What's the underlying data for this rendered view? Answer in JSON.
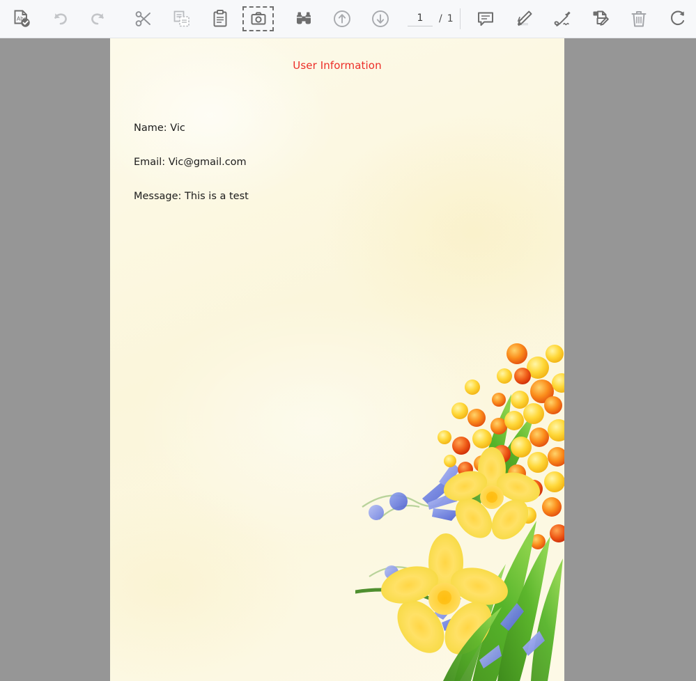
{
  "toolbar": {
    "buttons": [
      {
        "name": "spellcheck-document-icon",
        "label": "Check Document",
        "selected": false
      },
      {
        "name": "undo-icon",
        "label": "Undo",
        "selected": false
      },
      {
        "name": "redo-icon",
        "label": "Redo",
        "selected": false
      },
      {
        "name": "cut-scissors-icon",
        "label": "Cut",
        "selected": false
      },
      {
        "name": "copy-icon",
        "label": "Copy",
        "selected": false
      },
      {
        "name": "paste-clipboard-icon",
        "label": "Paste",
        "selected": false
      },
      {
        "name": "snapshot-camera-icon",
        "label": "Snapshot",
        "selected": true
      },
      {
        "name": "binoculars-find-icon",
        "label": "Find",
        "selected": false
      },
      {
        "name": "previous-page-arrow-up-icon",
        "label": "Previous Page",
        "selected": false
      },
      {
        "name": "next-page-arrow-down-icon",
        "label": "Next Page",
        "selected": false
      }
    ],
    "page_nav": {
      "current_page": "1",
      "separator": "/",
      "total_pages": "1"
    },
    "annotate_buttons": [
      {
        "name": "comment-bubble-icon",
        "label": "Add Comment",
        "selected": false
      },
      {
        "name": "highlighter-pen-icon",
        "label": "Highlight",
        "selected": false
      },
      {
        "name": "signature-pen-icon",
        "label": "Sign",
        "selected": false
      },
      {
        "name": "stamp-edit-document-icon",
        "label": "Edit Document",
        "selected": false
      },
      {
        "name": "trash-delete-icon",
        "label": "Delete",
        "selected": false
      },
      {
        "name": "rotate-refresh-icon",
        "label": "Rotate",
        "selected": false
      }
    ]
  },
  "document": {
    "title": "User Information",
    "title_color": "#ec2d27",
    "body_lines": [
      "Name: Vic",
      "Email: Vic@gmail.com",
      "Message: This is a test"
    ],
    "page_background": "#fdf9e4",
    "viewer_background": "#969696",
    "artwork": "floral-daffodil-mimosa-bluebell-watermark"
  }
}
